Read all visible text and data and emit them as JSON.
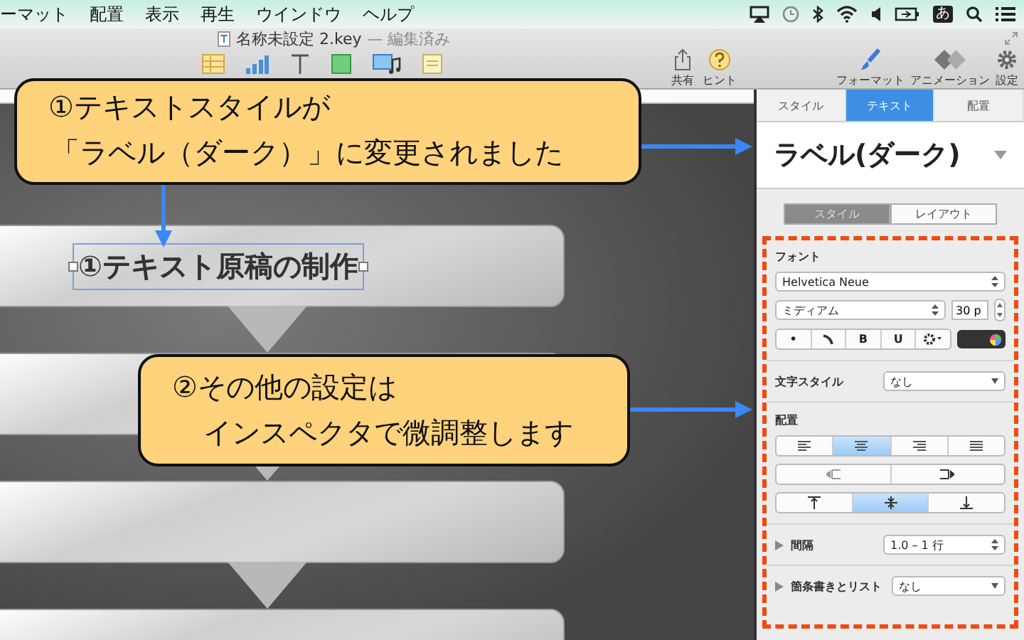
{
  "menu_bar": {
    "items": [
      "ーマット",
      "配置",
      "表示",
      "再生",
      "ウインドウ",
      "ヘルプ"
    ],
    "input_method": "あ"
  },
  "window": {
    "title": "名称未設定 2.key",
    "status": "— 編集済み"
  },
  "toolbar": {
    "actions": [
      {
        "kind": "share",
        "label": "共有"
      },
      {
        "kind": "hint",
        "label": "ヒント"
      }
    ],
    "panels": [
      {
        "kind": "format",
        "label": "フォーマット"
      },
      {
        "kind": "animation",
        "label": "アニメーション"
      },
      {
        "kind": "settings",
        "label": "設定"
      }
    ]
  },
  "canvas": {
    "boxes": [
      {
        "kind": "labeled",
        "label": "①テキスト原稿の制作",
        "selected": true
      },
      {
        "kind": "empty"
      },
      {
        "kind": "empty"
      },
      {
        "kind": "empty"
      }
    ]
  },
  "callouts": [
    {
      "lines": [
        "①テキストスタイルが",
        "「ラベル（ダーク）」に変更されました"
      ]
    },
    {
      "lines": [
        "②その他の設定は",
        "インスペクタで微調整します"
      ]
    }
  ],
  "inspector": {
    "tabs": [
      {
        "label": "スタイル",
        "selected": false
      },
      {
        "label": "テキスト",
        "selected": true
      },
      {
        "label": "配置",
        "selected": false
      }
    ],
    "style_name": "ラベル(ダーク)",
    "subtabs": [
      {
        "label": "スタイル",
        "selected": true
      },
      {
        "label": "レイアウト",
        "selected": false
      }
    ],
    "font": {
      "label": "フォント",
      "family": "Helvetica Neue",
      "weight": "ミディアム",
      "size": "30 p"
    },
    "style_buttons": [
      {
        "kind": "text",
        "label": "•"
      },
      {
        "kind": "curve"
      },
      {
        "kind": "text",
        "label": "B"
      },
      {
        "kind": "text",
        "label": "U"
      },
      {
        "kind": "gear"
      }
    ],
    "character_style": {
      "label": "文字スタイル",
      "value": "なし"
    },
    "alignment": {
      "label": "配置",
      "horizontal": [
        {
          "kind": "left",
          "selected": false
        },
        {
          "kind": "center",
          "selected": true
        },
        {
          "kind": "right",
          "selected": false
        },
        {
          "kind": "justify",
          "selected": false
        }
      ],
      "indent": [
        {
          "kind": "outdent"
        },
        {
          "kind": "indent"
        }
      ],
      "vertical": [
        {
          "kind": "top",
          "selected": false
        },
        {
          "kind": "middle",
          "selected": true
        },
        {
          "kind": "bottom",
          "selected": false
        }
      ]
    },
    "spacing": {
      "label": "間隔",
      "value": "1.0 – 1 行",
      "expanded": false
    },
    "bullets": {
      "label": "箇条書きとリスト",
      "value": "なし",
      "expanded": false
    }
  }
}
